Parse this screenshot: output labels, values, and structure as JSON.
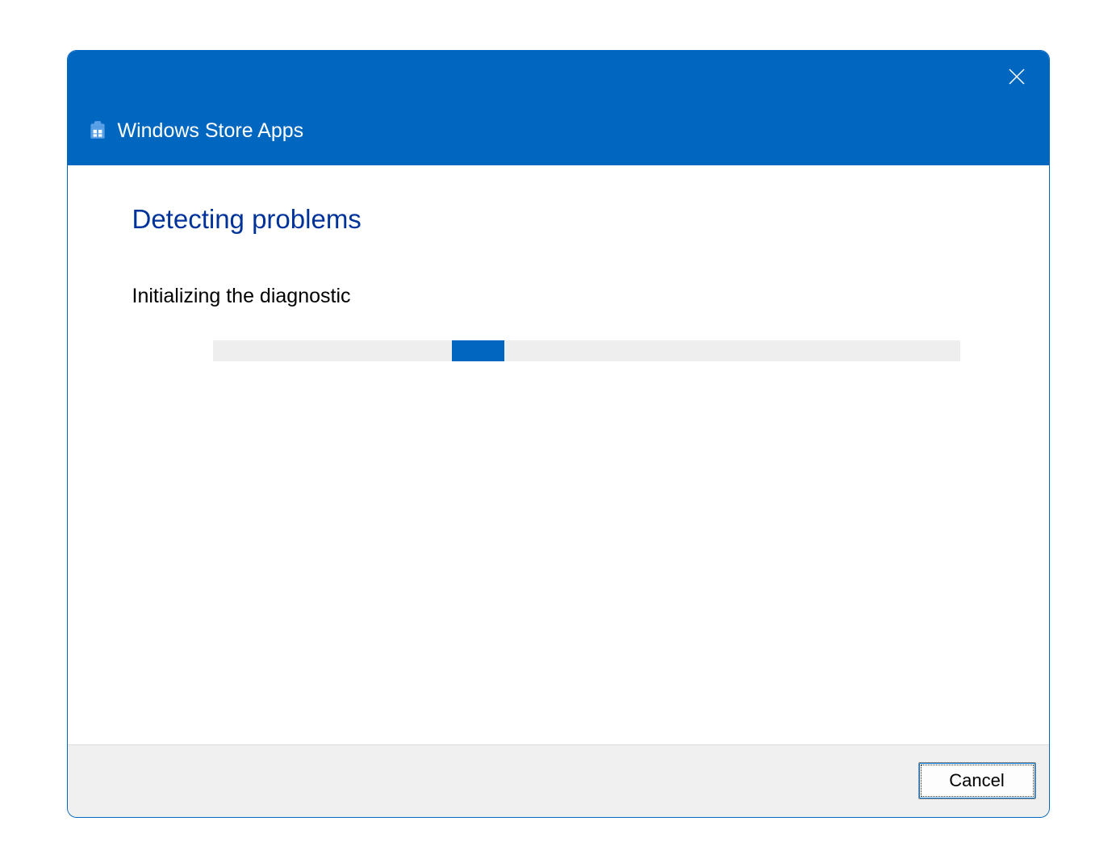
{
  "titlebar": {
    "title": "Windows Store Apps"
  },
  "content": {
    "heading": "Detecting problems",
    "status": "Initializing the diagnostic"
  },
  "footer": {
    "cancel_label": "Cancel"
  },
  "colors": {
    "accent": "#0067c0",
    "heading": "#003399"
  }
}
